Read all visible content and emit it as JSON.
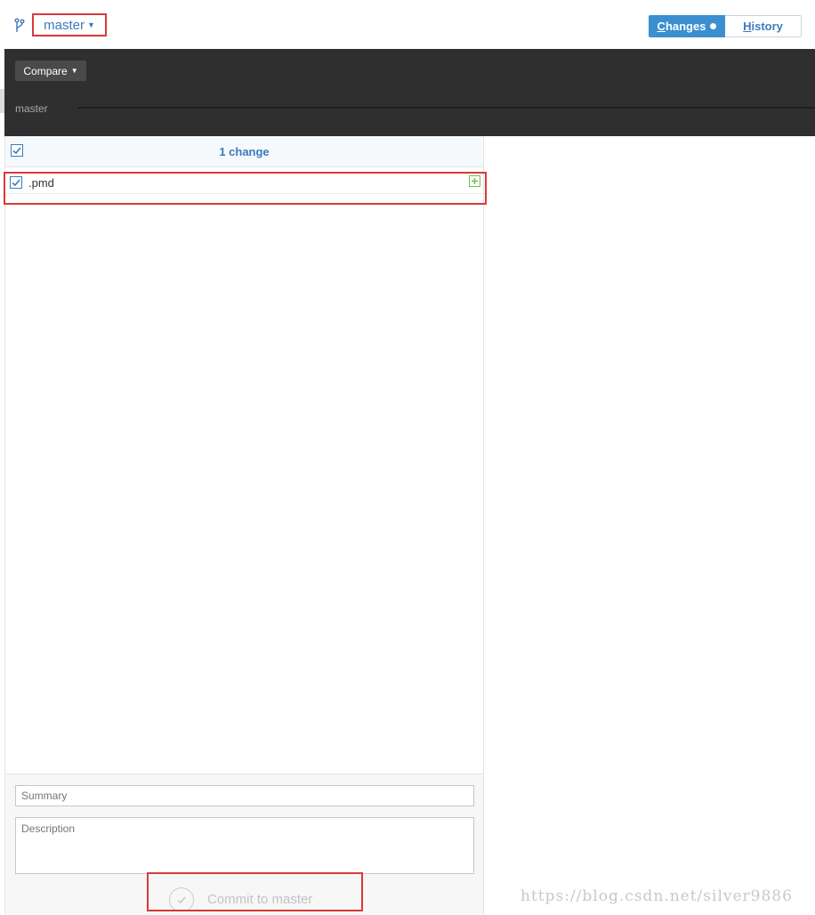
{
  "header": {
    "branch_name": "master",
    "branch_caret": "▼",
    "tabs": [
      {
        "prefix": "",
        "hotkey": "C",
        "rest": "hanges",
        "active": true
      },
      {
        "prefix": "",
        "hotkey": "H",
        "rest": "istory",
        "active": false
      }
    ]
  },
  "compare_bar": {
    "compare_label": "Compare",
    "compare_caret": "▼",
    "timeline_branch": "master"
  },
  "changes": {
    "count_label": "1 change",
    "files": [
      {
        "name": ".pmd",
        "status_icon": "plus-icon",
        "checked": true
      }
    ]
  },
  "commit": {
    "summary_placeholder": "Summary",
    "description_placeholder": "Description",
    "button_label": "Commit to master"
  },
  "watermark": "https://blog.csdn.net/silver9886",
  "colors": {
    "accent": "#3b8fd1",
    "link": "#3b7bbd",
    "highlight": "#d9393a",
    "added": "#6cc04a",
    "dark_bar": "#2f2f2f"
  }
}
